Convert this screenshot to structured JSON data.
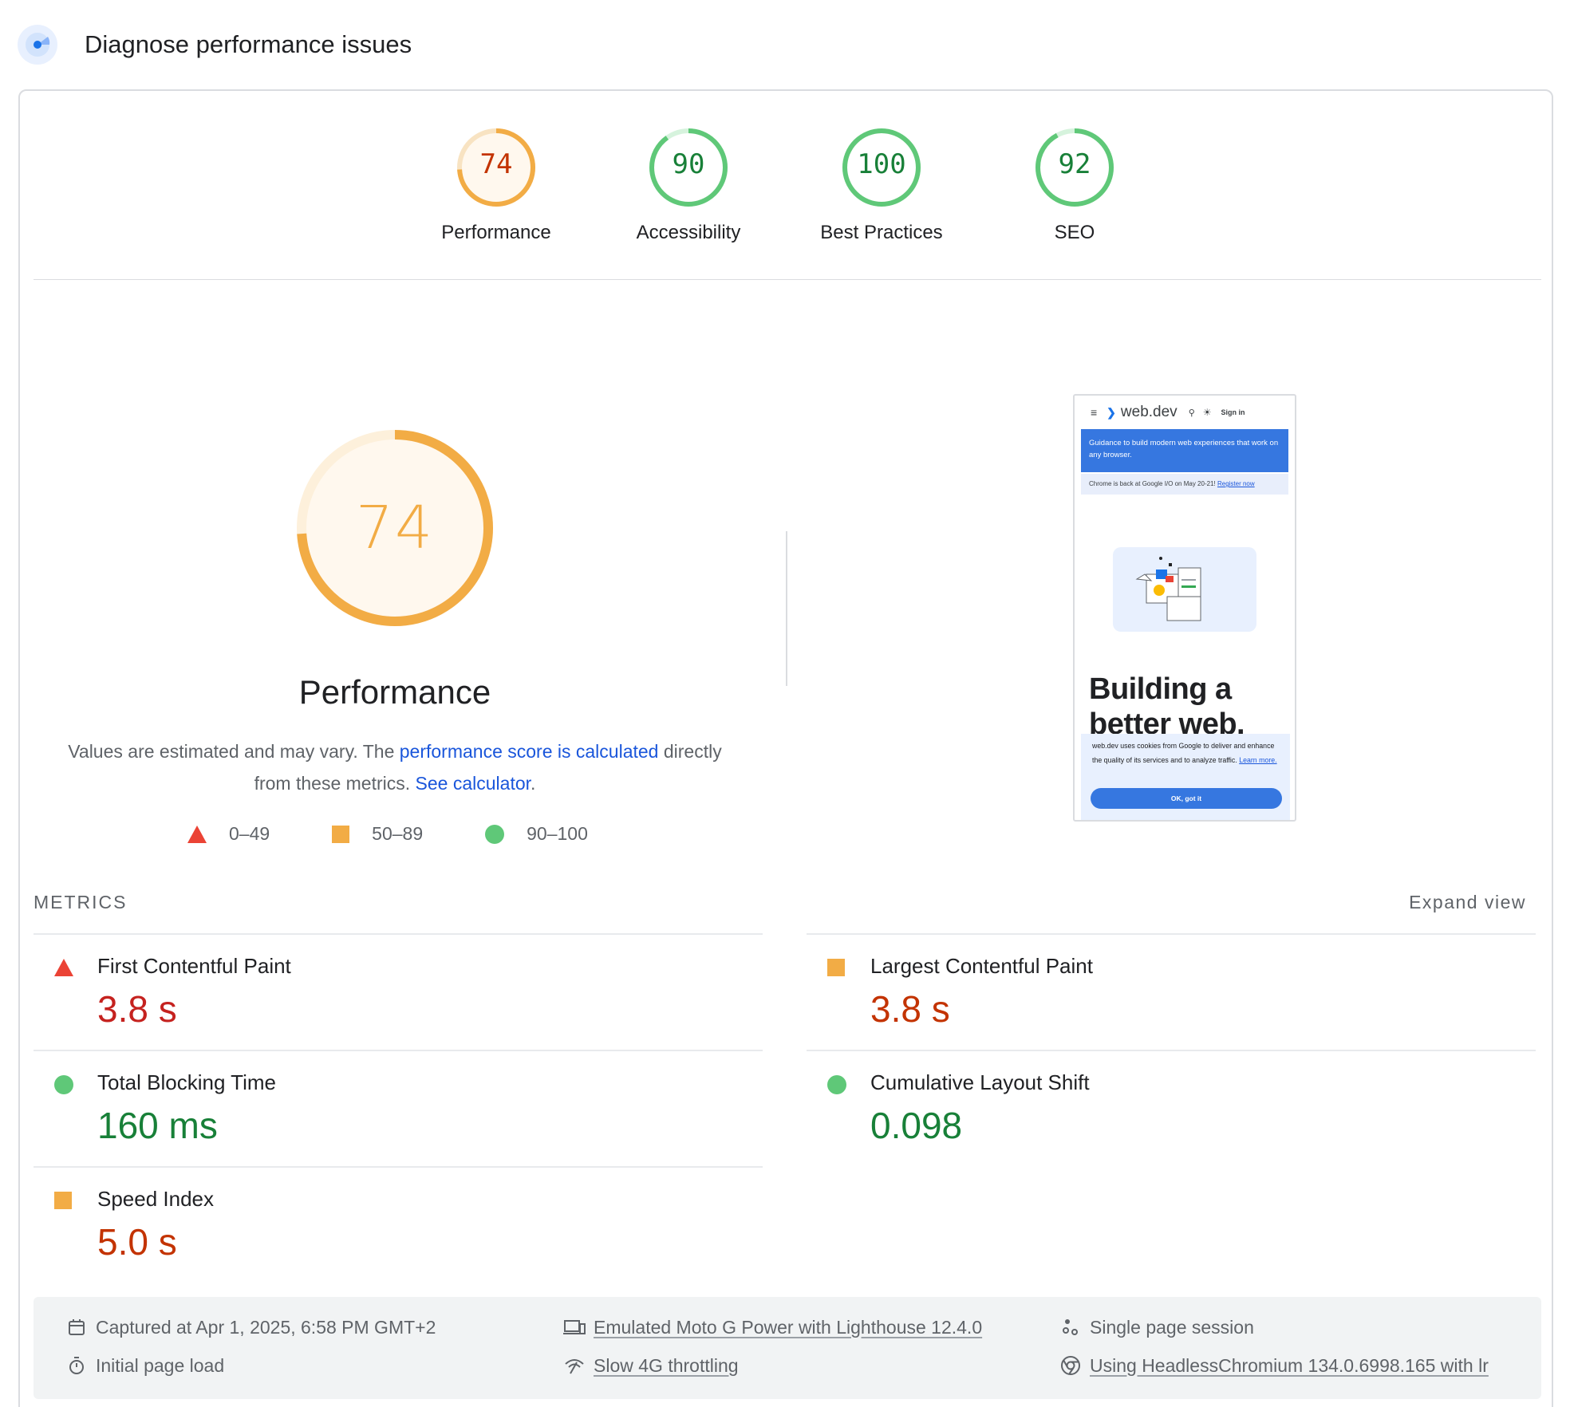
{
  "header": {
    "title": "Diagnose performance issues"
  },
  "categories": [
    {
      "label": "Performance",
      "score": "74",
      "fraction": 0.74,
      "color": "#f2ac45",
      "text_color": "#c33300",
      "bg": "#fff8ee"
    },
    {
      "label": "Accessibility",
      "score": "90",
      "fraction": 0.9,
      "color": "#5fc878",
      "text_color": "#188038",
      "bg": "#ffffff"
    },
    {
      "label": "Best Practices",
      "score": "100",
      "fraction": 1.0,
      "color": "#5fc878",
      "text_color": "#188038",
      "bg": "#ffffff"
    },
    {
      "label": "SEO",
      "score": "92",
      "fraction": 0.92,
      "color": "#5fc878",
      "text_color": "#188038",
      "bg": "#ffffff"
    }
  ],
  "performance": {
    "score": "74",
    "fraction": 0.74,
    "title": "Performance",
    "desc_prefix": "Values are estimated and may vary. The ",
    "desc_link": "performance score is calculated",
    "desc_middle": " directly from these metrics. ",
    "desc_link2": "See calculator",
    "desc_suffix": "."
  },
  "legend": {
    "fail": "0–49",
    "average": "50–89",
    "pass": "90–100"
  },
  "screenshot": {
    "brand": "web.dev",
    "signin": "Sign in",
    "banner": "Guidance to build modern web experiences that work on any browser.",
    "notice_text": "Chrome is back at Google I/O on May 20-21! ",
    "notice_link": "Register now",
    "heading": "Building a better web.",
    "cookie_text": "web.dev uses cookies from Google to deliver and enhance the quality of its services and to analyze traffic. ",
    "cookie_link": "Learn more.",
    "ok_button": "OK, got it"
  },
  "metrics": {
    "label": "METRICS",
    "expand": "Expand view",
    "fcp": {
      "title": "First Contentful Paint",
      "value": "3.8 s",
      "rating": "fail"
    },
    "lcp": {
      "title": "Largest Contentful Paint",
      "value": "3.8 s",
      "rating": "average"
    },
    "tbt": {
      "title": "Total Blocking Time",
      "value": "160 ms",
      "rating": "pass"
    },
    "cls": {
      "title": "Cumulative Layout Shift",
      "value": "0.098",
      "rating": "pass"
    },
    "si": {
      "title": "Speed Index",
      "value": "5.0 s",
      "rating": "average"
    }
  },
  "footer": {
    "captured": "Captured at Apr 1, 2025, 6:58 PM GMT+2",
    "load": "Initial page load",
    "device": "Emulated Moto G Power with Lighthouse 12.4.0",
    "throttling": "Slow 4G throttling",
    "session": "Single page session",
    "browser": "Using HeadlessChromium 134.0.6998.165 with lr"
  }
}
